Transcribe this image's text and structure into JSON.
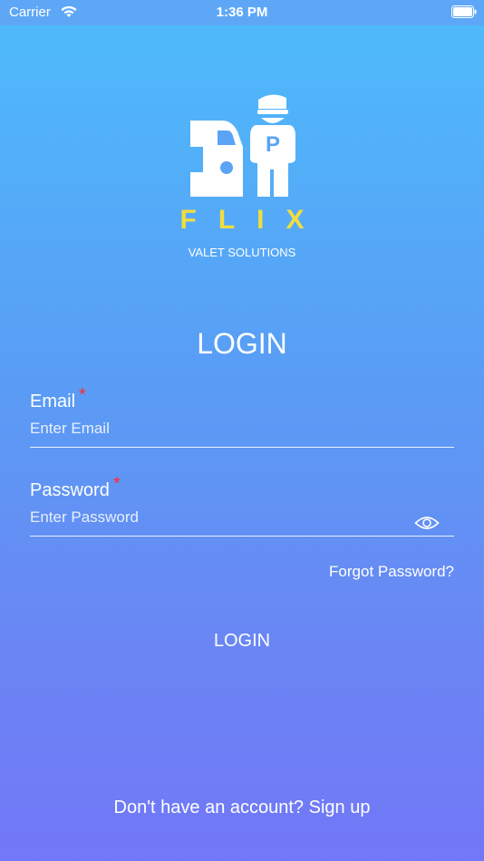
{
  "status_bar": {
    "carrier": "Carrier",
    "time": "1:36 PM"
  },
  "brand": {
    "name": "FLIX",
    "tagline": "VALET SOLUTIONS",
    "badge_letter": "P",
    "accent_color": "#f1dd3f"
  },
  "page": {
    "title": "LOGIN"
  },
  "form": {
    "email": {
      "label": "Email",
      "required_mark": "*",
      "placeholder": "Enter Email",
      "value": ""
    },
    "password": {
      "label": "Password",
      "required_mark": "*",
      "placeholder": "Enter Password",
      "value": "",
      "toggle_icon": "eye-icon"
    },
    "forgot_password": "Forgot Password?",
    "submit_label": "LOGIN"
  },
  "footer": {
    "signup_text": "Don't have an account? Sign up"
  },
  "colors": {
    "gradient_top": "#4dbcfb",
    "gradient_bottom": "#7277f7",
    "required": "#ff2b2b"
  }
}
